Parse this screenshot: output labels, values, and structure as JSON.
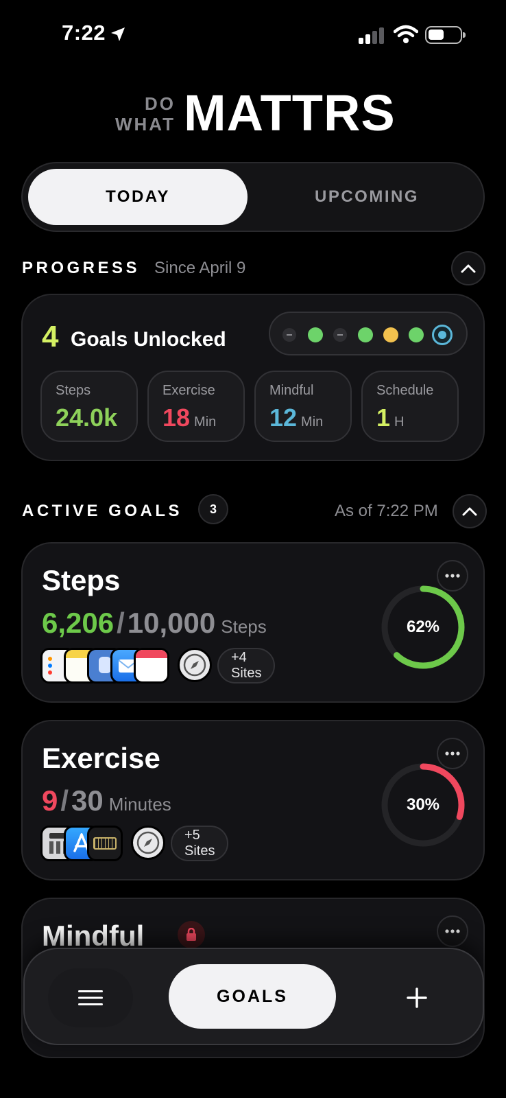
{
  "status_bar": {
    "time": "7:22"
  },
  "logo": {
    "line1": "DO",
    "line2": "WHAT",
    "brand": "MATTRS"
  },
  "tabs": [
    {
      "label": "TODAY",
      "selected": true
    },
    {
      "label": "UPCOMING",
      "selected": false
    }
  ],
  "progress": {
    "title": "PROGRESS",
    "since": "Since April 9",
    "goals_unlocked_count": "4",
    "goals_unlocked_label": "Goals Unlocked",
    "day_dots": [
      "dash",
      "green",
      "dash",
      "green",
      "yellow",
      "green",
      "ring-blue"
    ],
    "stats": [
      {
        "label": "Steps",
        "value": "24.0k",
        "unit": "",
        "color": "#8ed15a"
      },
      {
        "label": "Exercise",
        "value": "18",
        "unit": "Min",
        "color": "#f0485e"
      },
      {
        "label": "Mindful",
        "value": "12",
        "unit": "Min",
        "color": "#5bb7d9"
      },
      {
        "label": "Schedule",
        "value": "1",
        "unit": "H",
        "color": "#d4f063"
      }
    ]
  },
  "active_goals": {
    "title": "ACTIVE GOALS",
    "count": "3",
    "as_of": "As of 7:22 PM",
    "goals": [
      {
        "title": "Steps",
        "current": "6,206",
        "separator": "/",
        "target": "10,000",
        "unit": "Steps",
        "percent_label": "62%",
        "percent": 0.62,
        "color": "#6dc94a",
        "sites": "+4 Sites",
        "app_icons": [
          "reminders-icon",
          "notes-icon",
          "screen-time-icon",
          "mail-icon",
          "calendar-icon"
        ]
      },
      {
        "title": "Exercise",
        "current": "9",
        "separator": "/",
        "target": "30",
        "unit": "Minutes",
        "percent_label": "30%",
        "percent": 0.3,
        "color": "#f0485e",
        "sites": "+5 Sites",
        "app_icons": [
          "calculator-icon",
          "app-store-icon",
          "ruler-icon"
        ]
      },
      {
        "title": "Mindful",
        "locked": true
      }
    ]
  },
  "bottom_nav": {
    "center_label": "GOALS"
  }
}
